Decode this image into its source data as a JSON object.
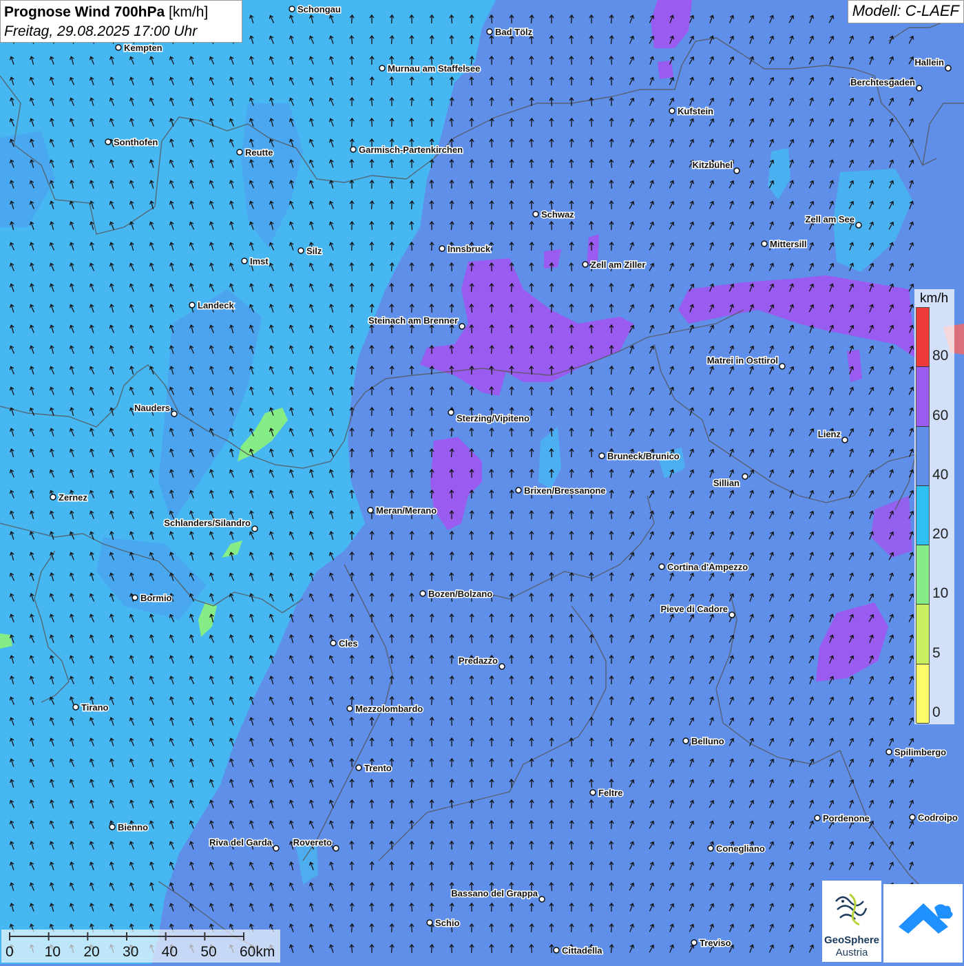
{
  "header": {
    "title_bold": "Prognose Wind 700hPa",
    "title_unit": "[km/h]",
    "datetime": "Freitag, 29.08.2025 17:00 Uhr",
    "model": "Modell: C-LAEF"
  },
  "legend": {
    "unit": "km/h",
    "classes": [
      {
        "label": "80",
        "color": "#f03a3a"
      },
      {
        "label": "60",
        "color": "#9a5cf0"
      },
      {
        "label": "40",
        "color": "#5f8fe8"
      },
      {
        "label": "20",
        "color": "#2fbff0"
      },
      {
        "label": "10",
        "color": "#86ec86"
      },
      {
        "label": "5",
        "color": "#c8f060"
      },
      {
        "label": "0",
        "color": "#fcfc6a"
      }
    ]
  },
  "scale_bar": {
    "ticks": [
      "0",
      "10",
      "20",
      "30",
      "40",
      "50",
      "60km"
    ]
  },
  "logos": {
    "geosphere_name": "GeoSphere",
    "geosphere_sub": "Austria"
  },
  "cities": [
    {
      "name": "Schongau"
    },
    {
      "name": "Bad Tölz"
    },
    {
      "name": "Kempten"
    },
    {
      "name": "Murnau am Staffelsee"
    },
    {
      "name": "Hallein"
    },
    {
      "name": "Berchtesgaden"
    },
    {
      "name": "Kufstein"
    },
    {
      "name": "Sonthofen"
    },
    {
      "name": "Reutte"
    },
    {
      "name": "Garmisch-Partenkirchen"
    },
    {
      "name": "Kitzbühel"
    },
    {
      "name": "Schwaz"
    },
    {
      "name": "Zell am See"
    },
    {
      "name": "Mittersill"
    },
    {
      "name": "Innsbruck"
    },
    {
      "name": "Silz"
    },
    {
      "name": "Imst"
    },
    {
      "name": "Zell am Ziller"
    },
    {
      "name": "Landeck"
    },
    {
      "name": "Steinach am Brenner"
    },
    {
      "name": "Matrei in Osttirol"
    },
    {
      "name": "Nauders"
    },
    {
      "name": "Sterzing/Vipiteno"
    },
    {
      "name": "Lienz"
    },
    {
      "name": "Bruneck/Brunico"
    },
    {
      "name": "Sillian"
    },
    {
      "name": "Brixen/Bressanone"
    },
    {
      "name": "Zernez"
    },
    {
      "name": "Meran/Merano"
    },
    {
      "name": "Schlanders/Silandro"
    },
    {
      "name": "Cortina d'Ampezzo"
    },
    {
      "name": "Bozen/Bolzano"
    },
    {
      "name": "Bormio"
    },
    {
      "name": "Pieve di Cadore"
    },
    {
      "name": "Cles"
    },
    {
      "name": "Predazzo"
    },
    {
      "name": "Tirano"
    },
    {
      "name": "Mezzolombardo"
    },
    {
      "name": "Belluno"
    },
    {
      "name": "Spilimbergo"
    },
    {
      "name": "Trento"
    },
    {
      "name": "Feltre"
    },
    {
      "name": "Pordenone"
    },
    {
      "name": "Codroipo"
    },
    {
      "name": "Bienno"
    },
    {
      "name": "Riva del Garda"
    },
    {
      "name": "Rovereto"
    },
    {
      "name": "Conegliano"
    },
    {
      "name": "Bassano del Grappa"
    },
    {
      "name": "Schio"
    },
    {
      "name": "Treviso"
    },
    {
      "name": "Cittadella"
    }
  ]
}
